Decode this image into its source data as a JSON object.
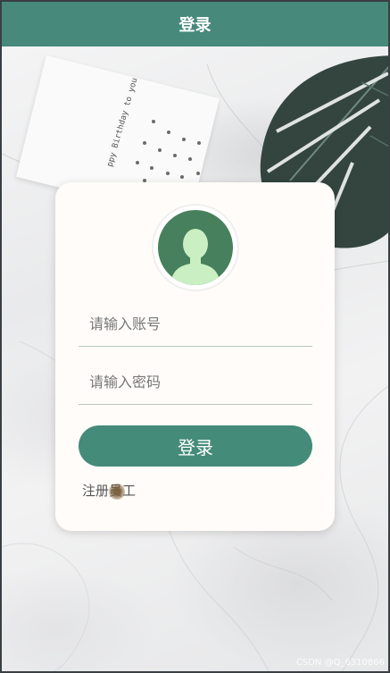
{
  "header": {
    "title": "登录"
  },
  "background": {
    "card_text": "ppy Birthday to you",
    "accent": "#47897a",
    "leaf_color": "#2f3f3a"
  },
  "login": {
    "username_placeholder": "请输入账号",
    "password_placeholder": "请输入密码",
    "login_button": "登录",
    "register_link": "注册员工",
    "button_color": "#458b79",
    "avatar_bg": "#47805c",
    "avatar_fg": "#c9efc2"
  },
  "watermark": "CSDN @Q_6310866",
  "icons": {
    "avatar": "user-avatar-icon"
  }
}
